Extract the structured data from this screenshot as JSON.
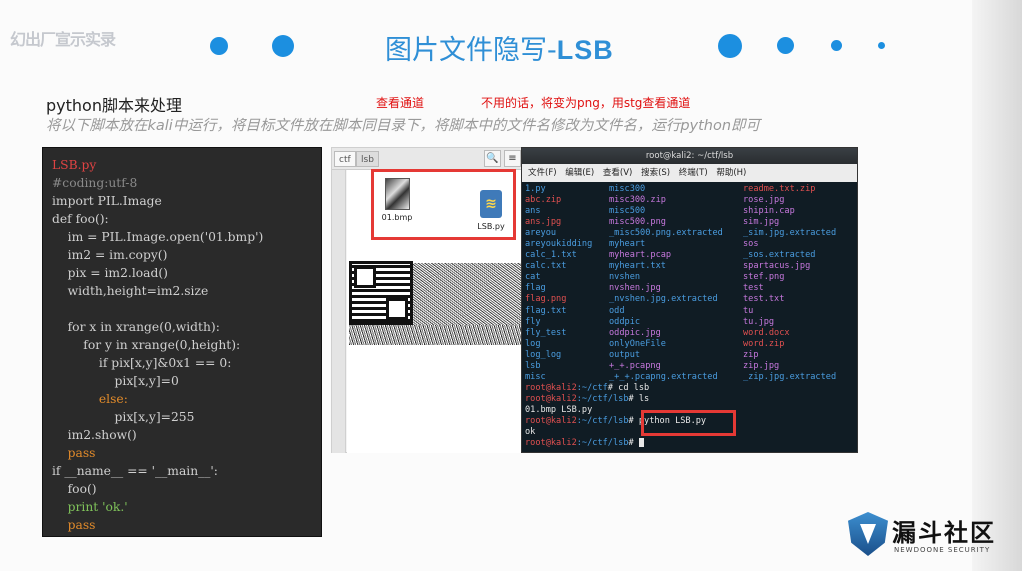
{
  "watermark": "幻出厂宣示实录",
  "title_cn": "图片文件隐写-",
  "title_en": "LSB",
  "heading": "python脚本来处理",
  "subtitle": "将以下脚本放在kali中运行，将目标文件放在脚本同目录下，将脚本中的文件名修改为文件名，运行python即可",
  "note_channel": "查看通道",
  "note_png": "不用的话，将变为png，用stg查看通道",
  "code_lines": [
    "LSB.py",
    "#coding:utf-8",
    "import PIL.Image",
    "def foo():",
    "    im = PIL.Image.open('01.bmp')",
    "    im2 = im.copy()",
    "    pix = im2.load()",
    "    width,height=im2.size",
    "",
    "    for x in xrange(0,width):",
    "        for y in xrange(0,height):",
    "            if pix[x,y]&0x1 == 0:",
    "                pix[x,y]=0",
    "            else:",
    "                pix[x,y]=255",
    "    im2.show()",
    "    pass",
    "if __name__ == '__main__':",
    "    foo()",
    "    print 'ok.'",
    "    pass"
  ],
  "fm": {
    "tab1": "ctf",
    "tab2": "lsb",
    "search": "🔍",
    "menu": "≡",
    "file1": "01.bmp",
    "file2": "LSB.py"
  },
  "term": {
    "title": "root@kali2: ~/ctf/lsb",
    "menu": "文件(F) 编辑(E) 查看(V) 搜索(S) 终端(T) 帮助(H)",
    "listing": [
      [
        "1.py",
        "misc300",
        "readme.txt.zip"
      ],
      [
        "abc.zip",
        "misc300.zip",
        "rose.jpg"
      ],
      [
        "ans",
        "misc500",
        "shipin.cap"
      ],
      [
        "ans.jpg",
        "misc500.png",
        "sim.jpg"
      ],
      [
        "areyou",
        "_misc500.png.extracted",
        "_sim.jpg.extracted"
      ],
      [
        "areyoukidding",
        "myheart",
        "sos"
      ],
      [
        "calc_1.txt",
        "myheart.pcap",
        "_sos.extracted"
      ],
      [
        "calc.txt",
        "myheart.txt",
        "spartacus.jpg"
      ],
      [
        "cat",
        "nvshen",
        "stef.png"
      ],
      [
        "flag",
        "nvshen.jpg",
        "test"
      ],
      [
        "flag.png",
        "_nvshen.jpg.extracted",
        "test.txt"
      ],
      [
        "flag.txt",
        "odd",
        "tu"
      ],
      [
        "fly",
        "oddpic",
        "tu.jpg"
      ],
      [
        "fly_test",
        "oddpic.jpg",
        "word.docx"
      ],
      [
        "log",
        "onlyOneFile",
        "word.zip"
      ],
      [
        "log_log",
        "output",
        "zip"
      ],
      [
        "lsb",
        "+_+.pcapng",
        "zip.jpg"
      ],
      [
        "misc",
        "_+_+.pcapng.extracted",
        "_zip.jpg.extracted"
      ]
    ],
    "prompt_user": "root@kali2",
    "p1_path": ":~/ctf",
    "p1_cmd": "# cd lsb",
    "p2_path": ":~/ctf/lsb",
    "p2_cmd": "# ls",
    "ls_out": "01.bmp  LSB.py",
    "p3_cmd": "# python LSB.py",
    "ok_out": "ok",
    "p4_cmd": "#"
  },
  "logo": {
    "cn": "漏斗社区",
    "en": "NEWDOONE SECURITY"
  }
}
